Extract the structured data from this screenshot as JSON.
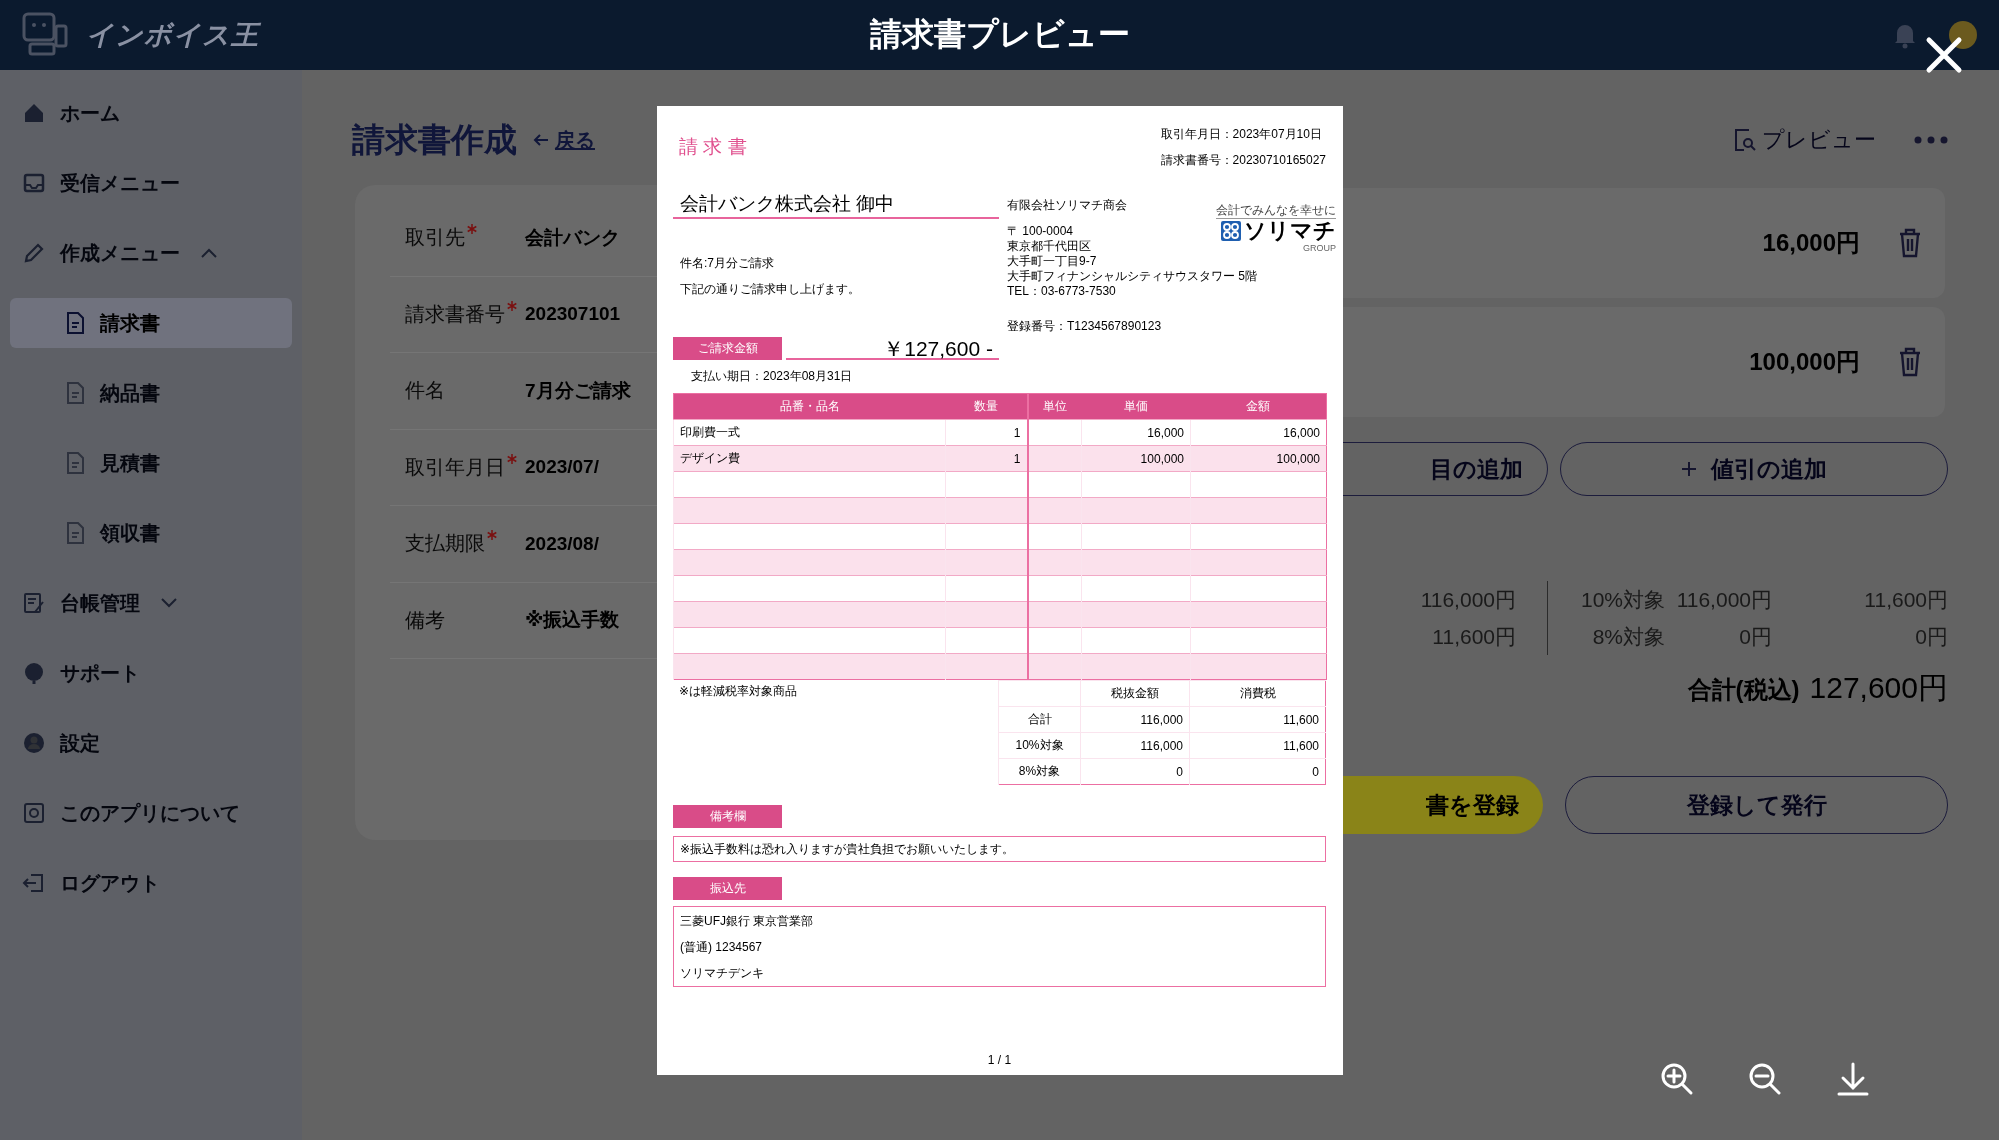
{
  "header": {
    "logo": "インボイス王",
    "title": "請求書プレビュー"
  },
  "sidebar": {
    "items": [
      {
        "label": "ホーム",
        "selected": false
      },
      {
        "label": "受信メニュー",
        "selected": false
      },
      {
        "label": "作成メニュー",
        "selected": false,
        "expanded": true,
        "children": [
          {
            "label": "請求書",
            "selected": true
          },
          {
            "label": "納品書",
            "selected": false
          },
          {
            "label": "見積書",
            "selected": false
          },
          {
            "label": "領収書",
            "selected": false
          }
        ]
      },
      {
        "label": "台帳管理",
        "selected": false,
        "expanded": false
      },
      {
        "label": "サポート",
        "selected": false
      },
      {
        "label": "設定",
        "selected": false
      },
      {
        "label": "このアプリについて",
        "selected": false
      },
      {
        "label": "ログアウト",
        "selected": false
      }
    ]
  },
  "form": {
    "title": "請求書作成",
    "back_link": "戻る",
    "rows": [
      {
        "label": "取引先",
        "required": true,
        "value": "会計バンク"
      },
      {
        "label": "請求書番号",
        "required": true,
        "value": "202307101"
      },
      {
        "label": "件名",
        "required": false,
        "value": "7月分ご請求"
      },
      {
        "label": "取引年月日",
        "required": true,
        "value": "2023/07/"
      },
      {
        "label": "支払期限",
        "required": true,
        "value": "2023/08/"
      },
      {
        "label": "備考",
        "required": false,
        "value": "※振込手数"
      }
    ]
  },
  "detail": {
    "preview_button": "プレビュー",
    "items": [
      {
        "amount": "16,000円"
      },
      {
        "amount": "100,000円"
      }
    ],
    "add_buttons": [
      {
        "label": "目の追加",
        "kind": "plain"
      },
      {
        "label": "値引の追加",
        "kind": "add"
      }
    ],
    "summary": [
      {
        "subtotal": "116,000円",
        "rate": "10%対象",
        "base": "116,000円",
        "tax": "11,600円"
      },
      {
        "subtotal": "11,600円",
        "rate": "8%対象",
        "base": "0円",
        "tax": "0円"
      }
    ],
    "total": {
      "label": "合計(税込)",
      "value": "127,600円"
    },
    "actions": [
      {
        "label": "書を登録",
        "kind": "primary"
      },
      {
        "label": "登録して発行",
        "kind": "outline"
      }
    ]
  },
  "invoice": {
    "title": "請 求 書",
    "date": "取引年月日：2023年07月10日",
    "number": "請求書番号：20230710165027",
    "recipient": "会計バンク株式会社 御中",
    "subject": "件名:7月分ご請求",
    "greeting": "下記の通りご請求申し上げます。",
    "sender": {
      "name": "有限会社ソリマチ商会",
      "address": [
        "〒 100-0004",
        "東京都千代田区",
        "大手町一丁目9-7",
        "大手町フィナンシャルシティサウスタワー 5階",
        "TEL：03-6773-7530"
      ],
      "registration": "登録番号：T1234567890123"
    },
    "logo": {
      "tagline": "会計でみんなを幸せに",
      "name": "ソリマチ",
      "group": "GROUP"
    },
    "amount_label": "ご請求金額",
    "amount": "￥127,600 -",
    "due": "支払い期日：2023年08月31日",
    "table": {
      "columns": [
        "品番・品名",
        "数量",
        "単位",
        "単価",
        "金額"
      ],
      "rows": [
        [
          "印刷費一式",
          "1",
          "",
          "16,000",
          "16,000"
        ],
        [
          "デザイン費",
          "1",
          "",
          "100,000",
          "100,000"
        ]
      ]
    },
    "footnote": "※は軽減税率対象商品",
    "totals": {
      "columns": [
        "税抜金額",
        "消費税"
      ],
      "rows": [
        {
          "label": "合計",
          "values": [
            "116,000",
            "11,600"
          ]
        },
        {
          "label": "10%対象",
          "values": [
            "116,000",
            "11,600"
          ]
        },
        {
          "label": "8%対象",
          "values": [
            "0",
            "0"
          ]
        }
      ]
    },
    "remarks": {
      "label": "備考欄",
      "text": "※振込手数料は恐れ入りますが貴社負担でお願いいたします。"
    },
    "bank": {
      "label": "振込先",
      "lines": [
        "三菱UFJ銀行 東京営業部",
        "(普通) 1234567",
        "ソリマチデンキ"
      ]
    },
    "page": "1 / 1"
  }
}
